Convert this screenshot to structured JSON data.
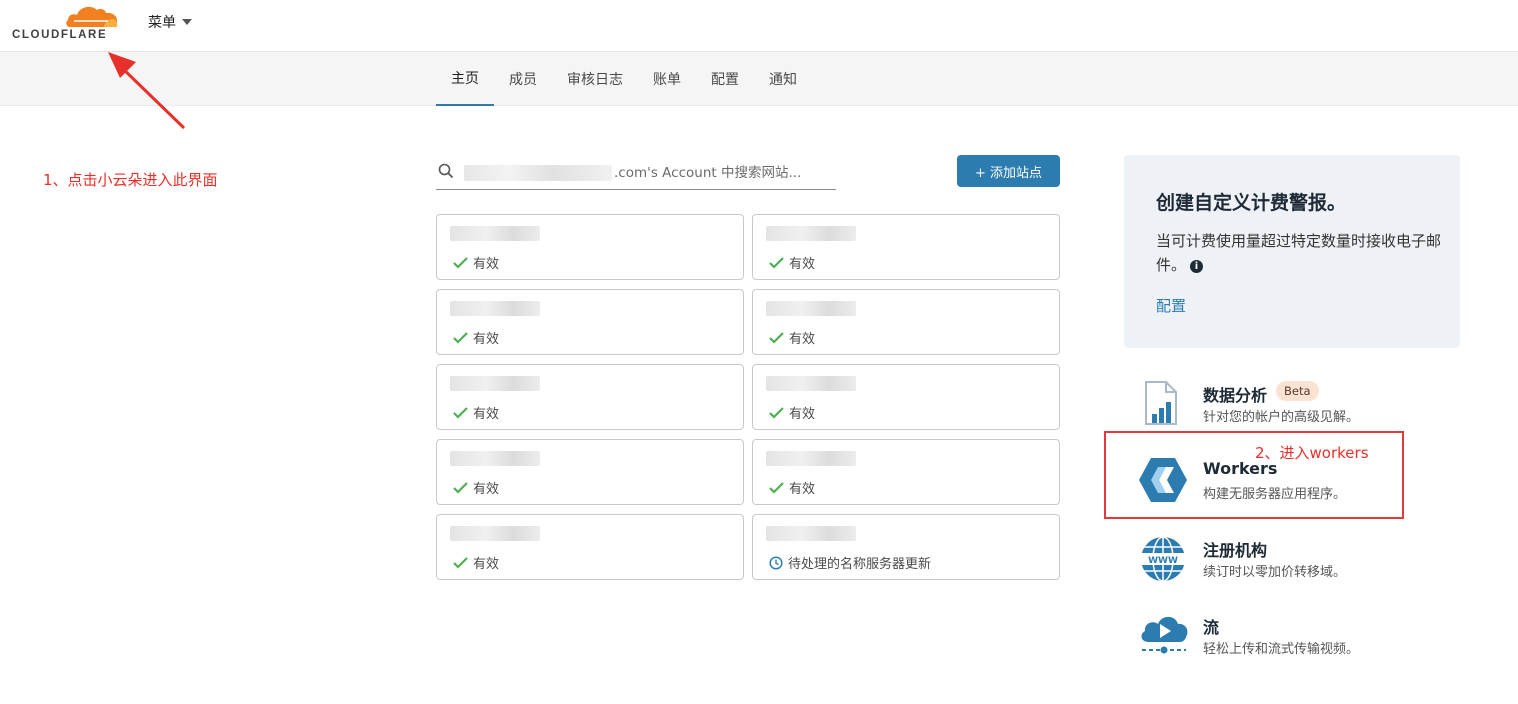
{
  "header": {
    "logo_text": "CLOUDFLARE",
    "menu_label": "菜单"
  },
  "nav": {
    "tabs": [
      {
        "label": "主页",
        "active": true
      },
      {
        "label": "成员"
      },
      {
        "label": "审核日志"
      },
      {
        "label": "账单"
      },
      {
        "label": "配置"
      },
      {
        "label": "通知"
      }
    ]
  },
  "annotations": {
    "step1": "1、点击小云朵进入此界面",
    "step2": "2、进入workers"
  },
  "search": {
    "placeholder": ".com's Account 中搜索网站..."
  },
  "add_site_label": "+ 添加站点",
  "sites": [
    {
      "status": "有效",
      "status_icon": "check-icon"
    },
    {
      "status": "有效",
      "status_icon": "check-icon"
    },
    {
      "status": "有效",
      "status_icon": "check-icon"
    },
    {
      "status": "有效",
      "status_icon": "check-icon"
    },
    {
      "status": "有效",
      "status_icon": "check-icon"
    },
    {
      "status": "有效",
      "status_icon": "check-icon"
    },
    {
      "status": "有效",
      "status_icon": "check-icon"
    },
    {
      "status": "有效",
      "status_icon": "check-icon"
    },
    {
      "status": "有效",
      "status_icon": "check-icon"
    },
    {
      "status": "待处理的名称服务器更新",
      "status_icon": "clock-icon"
    }
  ],
  "alert": {
    "title": "创建自定义计费警报。",
    "description": "当可计费使用量超过特定数量时接收电子邮件。",
    "link": "配置"
  },
  "products": [
    {
      "title": "数据分析",
      "badge": "Beta",
      "description": "针对您的帐户的高级见解。",
      "icon": "analytics-icon"
    },
    {
      "title": "Workers",
      "description": "构建无服务器应用程序。",
      "icon": "workers-icon"
    },
    {
      "title": "注册机构",
      "description": "续订时以零加价转移域。",
      "icon": "www-globe-icon"
    },
    {
      "title": "流",
      "description": "轻松上传和流式传输视频。",
      "icon": "stream-cloud-icon"
    }
  ],
  "colors": {
    "accent": "#2c7cb0",
    "annotation": "#e8302a",
    "valid": "#4caf50",
    "logo_orange": "#f38020"
  }
}
